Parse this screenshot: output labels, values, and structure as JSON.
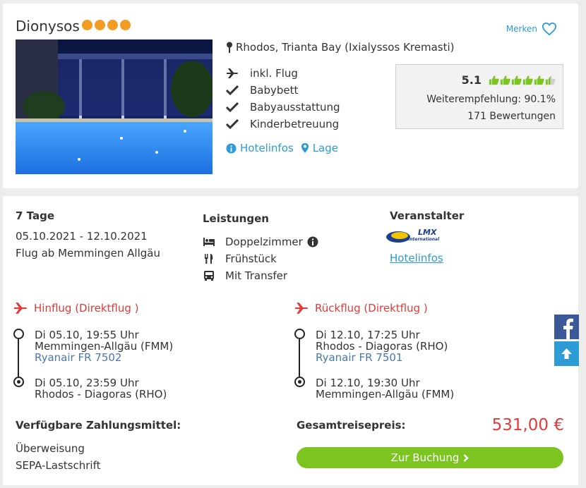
{
  "hotel": {
    "name": "Dionysos",
    "star_count": 4,
    "merken_label": "Merken",
    "location": "Rhodos, Trianta Bay (Ixialyssos Kremasti)",
    "features": [
      "inkl. Flug",
      "Babybett",
      "Babyausstattung",
      "Kinderbetreuung"
    ],
    "links": {
      "hotelinfos": "Hotelinfos",
      "lage": "Lage"
    },
    "rating": {
      "score": "5.1",
      "thumbs_filled": 5.5,
      "thumbs_total": 6,
      "recommendation": "Weiterempfehlung: 90.1%",
      "reviews": "171 Bewertungen"
    }
  },
  "offer": {
    "duration": "7 Tage",
    "dates": "05.10.2021 - 12.10.2021",
    "departure": "Flug ab Memmingen Allgäu",
    "services_title": "Leistungen",
    "services": [
      "Doppelzimmer",
      "Frühstück",
      "Mit Transfer"
    ],
    "operator_title": "Veranstalter",
    "operator_logo_text": "LMX",
    "operator_logo_sub": "International",
    "operator_link": "Hotelinfos",
    "outbound": {
      "title": "Hinflug (Direktflug )",
      "dep_time": "Di 05.10, 19:55 Uhr",
      "dep_airport": "Memmingen-Allgäu (FMM)",
      "flight": "Ryanair FR 7502",
      "arr_time": "Di 05.10, 23:59 Uhr",
      "arr_airport": "Rhodos - Diagoras (RHO)"
    },
    "return": {
      "title": "Rückflug (Direktflug )",
      "dep_time": "Di 12.10, 17:25 Uhr",
      "dep_airport": "Rhodos - Diagoras (RHO)",
      "flight": "Ryanair FR 7501",
      "arr_time": "Di 12.10, 19:30 Uhr",
      "arr_airport": "Memmingen-Allgäu (FMM)"
    },
    "payment_title": "Verfügbare Zahlungsmittel:",
    "payment_methods": [
      "Überweisung",
      "SEPA-Lastschrift"
    ],
    "total_label": "Gesamtreisepreis:",
    "total_price": "531,00 €",
    "book_label": "Zur Buchung"
  },
  "colors": {
    "accent_blue": "#2c9bd6",
    "star_orange": "#f39c23",
    "thumb_green": "#7cc41f",
    "flight_red": "#e23a3a",
    "book_green": "#7cc41f"
  }
}
